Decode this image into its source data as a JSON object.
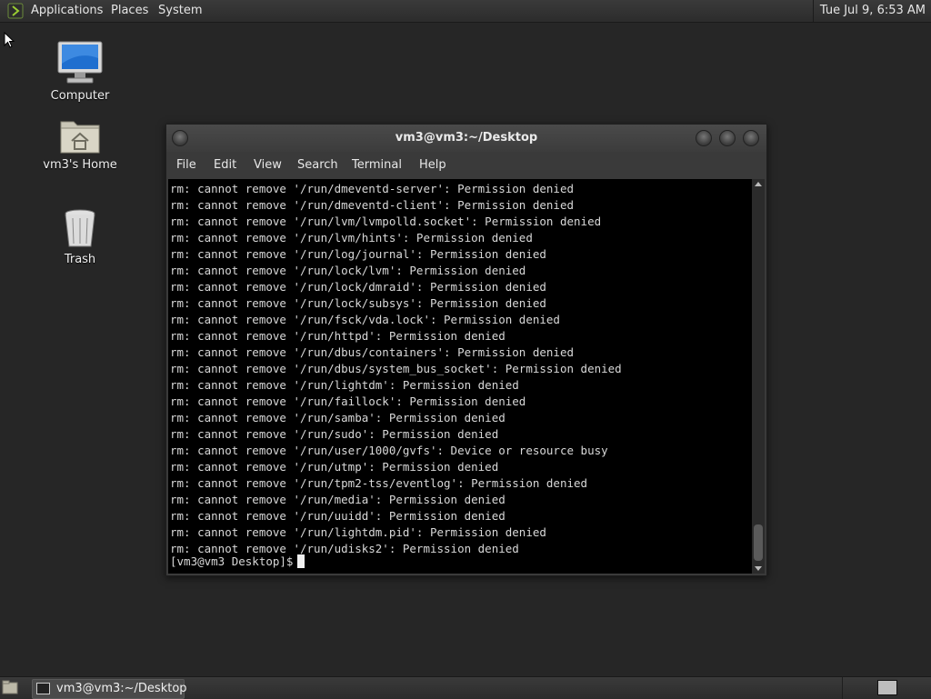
{
  "top_panel": {
    "menus": [
      "Applications",
      "Places",
      "System"
    ],
    "clock": "Tue Jul 9, 6:53 AM"
  },
  "desktop_icons": [
    {
      "label": "Computer",
      "icon": "computer-icon"
    },
    {
      "label": "vm3's Home",
      "icon": "home-folder-icon"
    },
    {
      "label": "Trash",
      "icon": "trash-icon"
    }
  ],
  "terminal": {
    "title": "vm3@vm3:~/Desktop",
    "menu": [
      "File",
      "Edit",
      "View",
      "Search",
      "Terminal",
      "Help"
    ],
    "lines": [
      "rm: cannot remove '/run/dmeventd-server': Permission denied",
      "rm: cannot remove '/run/dmeventd-client': Permission denied",
      "rm: cannot remove '/run/lvm/lvmpolld.socket': Permission denied",
      "rm: cannot remove '/run/lvm/hints': Permission denied",
      "rm: cannot remove '/run/log/journal': Permission denied",
      "rm: cannot remove '/run/lock/lvm': Permission denied",
      "rm: cannot remove '/run/lock/dmraid': Permission denied",
      "rm: cannot remove '/run/lock/subsys': Permission denied",
      "rm: cannot remove '/run/fsck/vda.lock': Permission denied",
      "rm: cannot remove '/run/httpd': Permission denied",
      "rm: cannot remove '/run/dbus/containers': Permission denied",
      "rm: cannot remove '/run/dbus/system_bus_socket': Permission denied",
      "rm: cannot remove '/run/lightdm': Permission denied",
      "rm: cannot remove '/run/faillock': Permission denied",
      "rm: cannot remove '/run/samba': Permission denied",
      "rm: cannot remove '/run/sudo': Permission denied",
      "rm: cannot remove '/run/user/1000/gvfs': Device or resource busy",
      "rm: cannot remove '/run/utmp': Permission denied",
      "rm: cannot remove '/run/tpm2-tss/eventlog': Permission denied",
      "rm: cannot remove '/run/media': Permission denied",
      "rm: cannot remove '/run/uuidd': Permission denied",
      "rm: cannot remove '/run/lightdm.pid': Permission denied",
      "rm: cannot remove '/run/udisks2': Permission denied"
    ],
    "prompt": "[vm3@vm3 Desktop]$"
  },
  "taskbar": {
    "task_label": "vm3@vm3:~/Desktop"
  }
}
